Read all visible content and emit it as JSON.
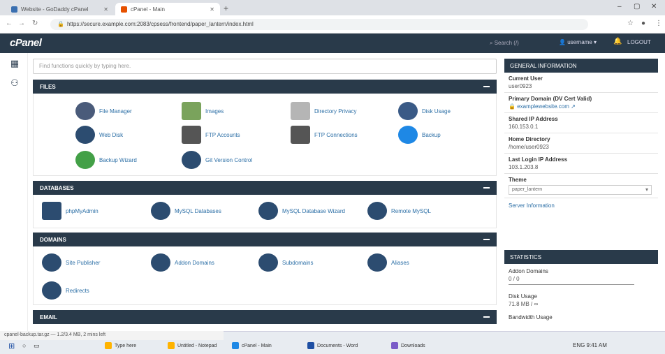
{
  "browser": {
    "tabs": [
      {
        "title": "Website - GoDaddy cPanel",
        "active": false
      },
      {
        "title": "cPanel - Main",
        "active": true
      }
    ],
    "url": "https://secure.example.com:2083/cpsess/frontend/paper_lantern/index.html"
  },
  "header": {
    "logo": "cPanel",
    "search_placeholder": "Search (/)",
    "user_label": "username",
    "logout_label": "LOGOUT"
  },
  "filter": {
    "placeholder": "Find functions quickly by typing here."
  },
  "sections": [
    {
      "title": "FILES",
      "items": [
        {
          "label": "File Manager",
          "icon": "file-manager-icon",
          "color": "#4a5b7a"
        },
        {
          "label": "Images",
          "icon": "images-icon",
          "color": "#7aa35c"
        },
        {
          "label": "Directory Privacy",
          "icon": "directory-privacy-icon",
          "color": "#b5b5b5"
        },
        {
          "label": "Disk Usage",
          "icon": "disk-usage-icon",
          "color": "#3a5a86"
        },
        {
          "label": "Web Disk",
          "icon": "web-disk-icon",
          "color": "#2c4c70"
        },
        {
          "label": "FTP Accounts",
          "icon": "ftp-accounts-icon",
          "color": "#555555"
        },
        {
          "label": "FTP Connections",
          "icon": "ftp-connections-icon",
          "color": "#555555"
        },
        {
          "label": "Backup",
          "icon": "backup-icon",
          "color": "#1e88e5"
        },
        {
          "label": "Backup Wizard",
          "icon": "backup-wizard-icon",
          "color": "#43a047"
        },
        {
          "label": "Git Version Control",
          "icon": "git-icon",
          "color": "#2c4c70"
        }
      ]
    },
    {
      "title": "DATABASES",
      "items": [
        {
          "label": "phpMyAdmin",
          "icon": "phpmyadmin-icon",
          "color": "#2c4c70"
        },
        {
          "label": "MySQL Databases",
          "icon": "mysql-databases-icon",
          "color": "#2c4c70"
        },
        {
          "label": "MySQL Database Wizard",
          "icon": "mysql-wizard-icon",
          "color": "#2c4c70"
        },
        {
          "label": "Remote MySQL",
          "icon": "remote-mysql-icon",
          "color": "#2c4c70"
        }
      ]
    },
    {
      "title": "DOMAINS",
      "items": [
        {
          "label": "Site Publisher",
          "icon": "site-publisher-icon",
          "color": "#2c4c70"
        },
        {
          "label": "Addon Domains",
          "icon": "addon-domains-icon",
          "color": "#2c4c70"
        },
        {
          "label": "Subdomains",
          "icon": "subdomains-icon",
          "color": "#2c4c70"
        },
        {
          "label": "Aliases",
          "icon": "aliases-icon",
          "color": "#2c4c70"
        },
        {
          "label": "Redirects",
          "icon": "redirects-icon",
          "color": "#2c4c70"
        }
      ]
    },
    {
      "title": "EMAIL",
      "items": []
    }
  ],
  "general_info": {
    "title": "GENERAL INFORMATION",
    "current_user_label": "Current User",
    "current_user": "user0923",
    "primary_domain_label": "Primary Domain (DV Cert Valid)",
    "primary_domain": "examplewebsite.com",
    "shared_ip_label": "Shared IP Address",
    "shared_ip": "160.153.0.1",
    "home_dir_label": "Home Directory",
    "home_dir": "/home/user0923",
    "last_login_label": "Last Login IP Address",
    "last_login": "103.1.203.8",
    "theme_label": "Theme",
    "theme": "paper_lantern",
    "server_info": "Server Information"
  },
  "statistics": {
    "title": "STATISTICS",
    "domains_label": "Addon Domains",
    "domains_value": "0 / 0",
    "disk_label": "Disk Usage",
    "disk_value": "71.8 MB / ∞",
    "bandwidth_label": "Bandwidth Usage"
  },
  "taskbar": {
    "download": "cpanel-backup.tar.gz — 1.2/3.4 MB, 2 mins left",
    "items": [
      {
        "label": "Type here",
        "color": "#ffb300"
      },
      {
        "label": "Untitled - Notepad",
        "color": "#ffb300"
      },
      {
        "label": "cPanel - Main",
        "color": "#1e88e5"
      },
      {
        "label": "Documents - Word",
        "color": "#1e4fa3"
      },
      {
        "label": "Downloads",
        "color": "#7a5cc8"
      }
    ],
    "tray": "ENG 9:41 AM"
  }
}
